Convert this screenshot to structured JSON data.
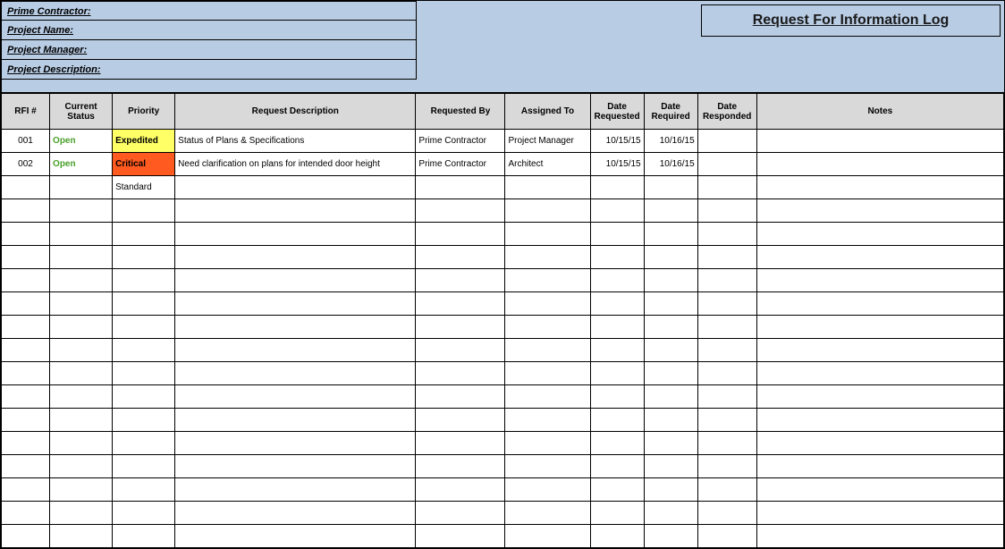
{
  "header": {
    "fields": {
      "prime_contractor": "Prime Contractor:",
      "project_name": "Project Name:",
      "project_manager": "Project Manager:",
      "project_description": "Project Description:"
    },
    "title": "Request For Information Log"
  },
  "columns": {
    "rfi": "RFI #",
    "status": "Current Status",
    "priority": "Priority",
    "description": "Request Description",
    "requested_by": "Requested By",
    "assigned_to": "Assigned To",
    "date_requested": "Date Requested",
    "date_required": "Date Required",
    "date_responded": "Date Responded",
    "notes": "Notes"
  },
  "rows": [
    {
      "rfi": "001",
      "status": "Open",
      "priority": "Expedited",
      "priority_class": "exp",
      "description": "Status of Plans & Specifications",
      "requested_by": "Prime Contractor",
      "assigned_to": "Project Manager",
      "date_requested": "10/15/15",
      "date_required": "10/16/15",
      "date_responded": "",
      "notes": ""
    },
    {
      "rfi": "002",
      "status": "Open",
      "priority": "Critical",
      "priority_class": "crit",
      "description": "Need clarification on plans for intended door height",
      "requested_by": "Prime Contractor",
      "assigned_to": "Architect",
      "date_requested": "10/15/15",
      "date_required": "10/16/15",
      "date_responded": "",
      "notes": ""
    },
    {
      "rfi": "",
      "status": "",
      "priority": "Standard",
      "priority_class": "",
      "description": "",
      "requested_by": "",
      "assigned_to": "",
      "date_requested": "",
      "date_required": "",
      "date_responded": "",
      "notes": ""
    }
  ],
  "empty_row_count": 15
}
